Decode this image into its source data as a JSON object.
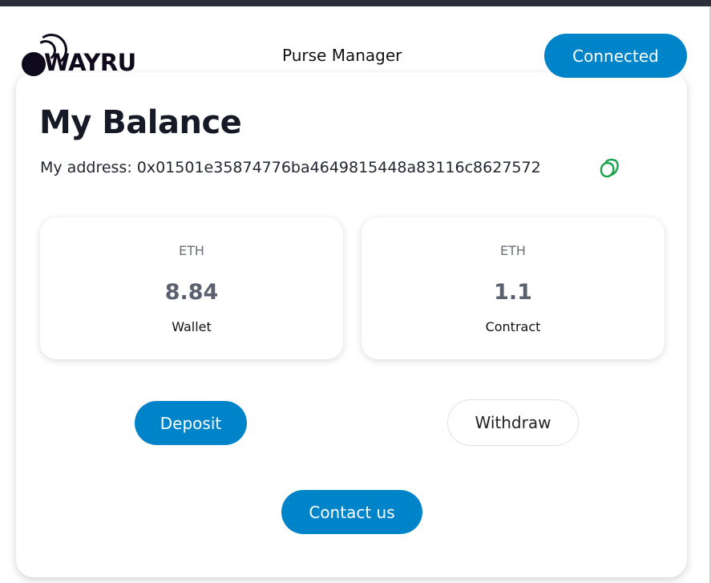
{
  "header": {
    "logo_text": "WAYRU",
    "nav_title": "Purse Manager",
    "connect_label": "Connected"
  },
  "balance": {
    "title": "My Balance",
    "address_label": "My address: ",
    "address": "0x01501e35874776ba4649815448a83116c8627572",
    "copy_icon": "copy-icon"
  },
  "cards": [
    {
      "currency": "ETH",
      "amount": "8.84",
      "label": "Wallet"
    },
    {
      "currency": "ETH",
      "amount": "1.1",
      "label": "Contract"
    }
  ],
  "actions": {
    "deposit_label": "Deposit",
    "withdraw_label": "Withdraw",
    "contact_label": "Contact us"
  },
  "colors": {
    "accent": "#0084c9",
    "copy_icon": "#1aa34a",
    "topbar": "#2a2f3a"
  }
}
